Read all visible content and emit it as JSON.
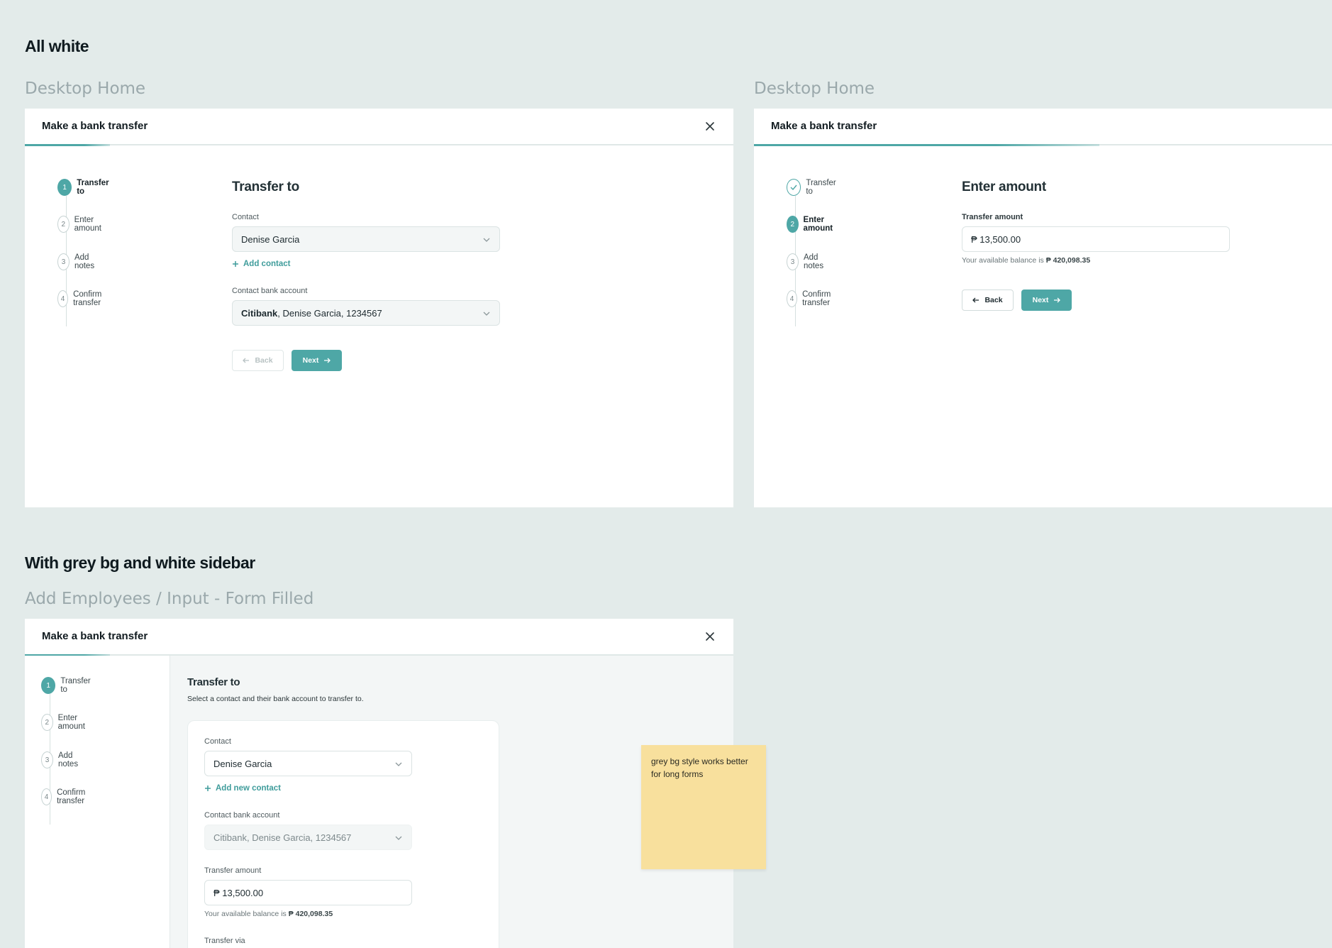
{
  "sections": {
    "all_white": "All white",
    "grey_bg": "With grey bg and white sidebar"
  },
  "frames": {
    "frame1_label": "Desktop Home",
    "frame2_label": "Desktop Home",
    "frame3_label": "Add Employees / Input - Form Filled"
  },
  "modal": {
    "title": "Make a bank transfer"
  },
  "steps": [
    {
      "num": "1",
      "label": "Transfer to"
    },
    {
      "num": "2",
      "label": "Enter amount"
    },
    {
      "num": "3",
      "label": "Add notes"
    },
    {
      "num": "4",
      "label": "Confirm transfer"
    }
  ],
  "frame1": {
    "heading": "Transfer to",
    "contact_label": "Contact",
    "contact_value": "Denise Garcia",
    "add_contact": "Add contact",
    "bank_label": "Contact bank account",
    "bank_name": "Citibank",
    "bank_rest": ", Denise Garcia, 1234567",
    "back": "Back",
    "next": "Next"
  },
  "frame2": {
    "heading": "Enter amount",
    "amount_label": "Transfer amount",
    "amount_value": "₱ 13,500.00",
    "balance_prefix": "Your available balance is ",
    "balance_value": "₱ 420,098.35",
    "back": "Back",
    "next": "Next"
  },
  "frame3": {
    "heading": "Transfer to",
    "subtitle": "Select a contact and their bank account to transfer to.",
    "contact_label": "Contact",
    "contact_value": "Denise Garcia",
    "add_contact": "Add new contact",
    "bank_label": "Contact bank account",
    "bank_value": "Citibank, Denise Garcia, 1234567",
    "amount_label": "Transfer amount",
    "amount_value": "₱ 13,500.00",
    "balance_prefix": "Your available balance is ",
    "balance_value": "₱ 420,098.35",
    "transfer_via_label": "Transfer via"
  },
  "sticky_note": "grey bg style works better for long forms",
  "colors": {
    "accent": "#4ea7a6",
    "background": "#e3ebea",
    "sticky": "#f8e09d"
  }
}
